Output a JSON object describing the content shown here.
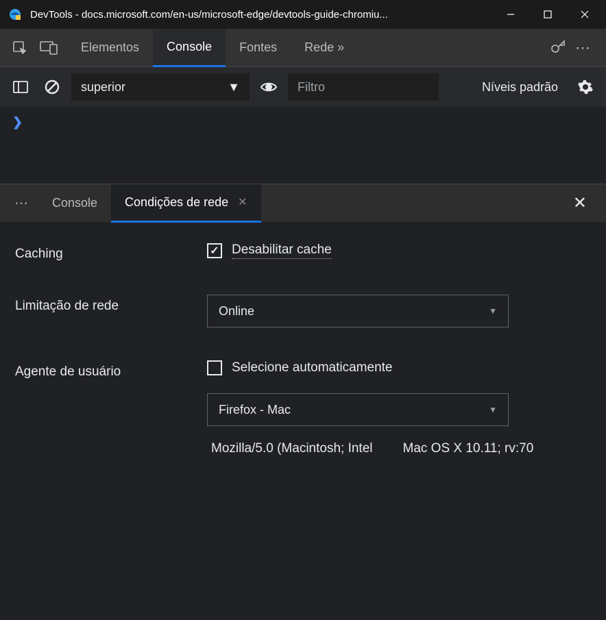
{
  "titlebar": {
    "title": "DevTools - docs.microsoft.com/en-us/microsoft-edge/devtools-guide-chromiu..."
  },
  "main_tabs": {
    "items": [
      {
        "label": "Elementos"
      },
      {
        "label": "Console"
      },
      {
        "label": "Fontes"
      },
      {
        "label": "Rede »"
      }
    ]
  },
  "console_toolbar": {
    "context": "superior",
    "filter_placeholder": "Filtro",
    "levels_label": "Níveis padrão"
  },
  "drawer": {
    "tabs": [
      {
        "label": "Console"
      },
      {
        "label": "Condições de rede"
      }
    ]
  },
  "network_conditions": {
    "caching_label": "Caching",
    "disable_cache_label": "Desabilitar cache",
    "throttling_label": "Limitação de rede",
    "throttling_value": "Online",
    "user_agent_label": "Agente de usuário",
    "auto_select_label": "Selecione automaticamente",
    "ua_preset": "Firefox - Mac",
    "ua_string_part1": "Mozilla/5.0 (Macintosh; Intel",
    "ua_string_part2": "Mac OS X 10.11; rv:70"
  }
}
